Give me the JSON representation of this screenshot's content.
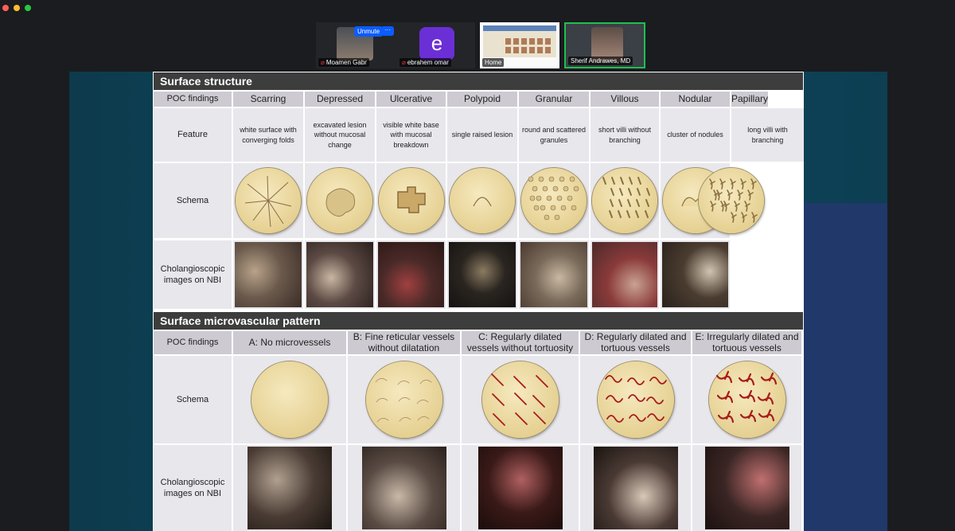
{
  "window": {
    "dots": [
      "#ff5f57",
      "#febc2e",
      "#28c840"
    ]
  },
  "participants": {
    "unmute_label": "Unmute",
    "more_label": "···",
    "p1_name": "Moamen Gabr",
    "p2_initial": "e",
    "p2_name": "ebrahem omar",
    "p3_name": "Home",
    "p4_name": "Sherif Andrawes, MD"
  },
  "surface_structure": {
    "title": "Surface structure",
    "row_labels": {
      "findings": "POC findings",
      "feature": "Feature",
      "schema": "Schema",
      "images": "Cholangioscopic images on NBI"
    },
    "columns": [
      {
        "name": "Scarring",
        "feature": "white surface with converging folds"
      },
      {
        "name": "Depressed",
        "feature": "excavated lesion without mucosal change"
      },
      {
        "name": "Ulcerative",
        "feature": "visible white base with mucosal breakdown"
      },
      {
        "name": "Polypoid",
        "feature": "single raised lesion"
      },
      {
        "name": "Granular",
        "feature": "round and scattered granules"
      },
      {
        "name": "Villous",
        "feature": "short villi without branching"
      },
      {
        "name": "Nodular",
        "feature": "cluster of nodules"
      },
      {
        "name": "Papillary",
        "feature": "long villi with branching"
      }
    ]
  },
  "microvascular": {
    "title": "Surface microvascular pattern",
    "row_labels": {
      "findings": "POC findings",
      "schema": "Schema",
      "images": "Cholangioscopic images on NBI"
    },
    "columns": [
      {
        "name": "A: No microvessels"
      },
      {
        "name": "B: Fine reticular vessels without dilatation"
      },
      {
        "name": "C: Regularly dilated vessels without tortuosity"
      },
      {
        "name": "D: Regularly dilated and tortuous vessels"
      },
      {
        "name": "E: Irregularly dilated and tortuous vessels"
      }
    ]
  }
}
